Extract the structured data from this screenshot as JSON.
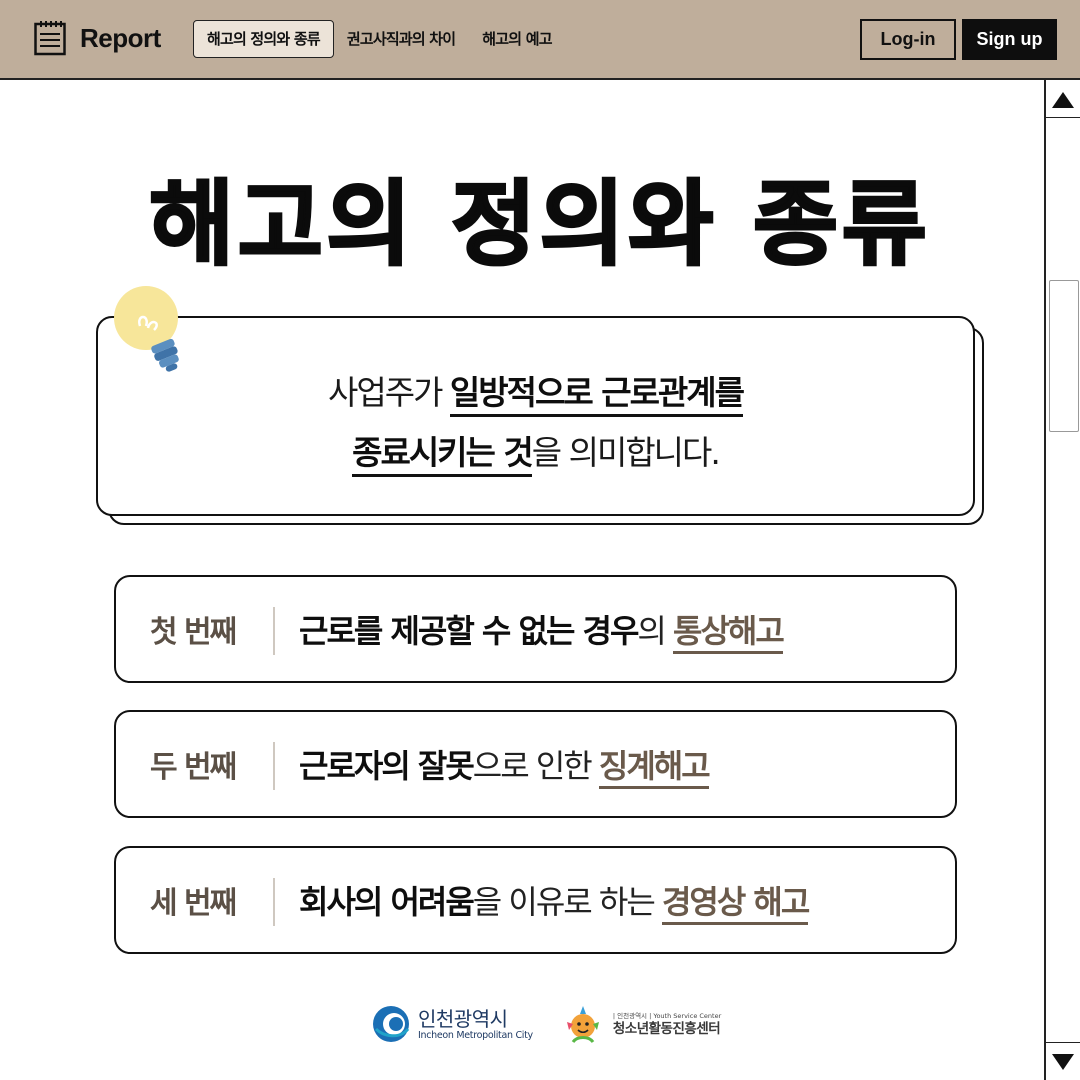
{
  "header": {
    "app_title": "Report",
    "tabs": [
      {
        "label": "해고의 정의와 종류",
        "active": true
      },
      {
        "label": "권고사직과의 차이",
        "active": false
      },
      {
        "label": "해고의 예고",
        "active": false
      }
    ],
    "login_label": "Log-in",
    "signup_label": "Sign up",
    "bar_color": "#bfae9b"
  },
  "main": {
    "title": "해고의 정의와 종류",
    "definition": {
      "line1_prefix": "사업주가 ",
      "line1_highlight": "일방적으로 근로관계를",
      "line2_highlight": "종료시키는 것",
      "line2_suffix": "을 의미합니다."
    },
    "types": [
      {
        "ordinal": "첫 번째",
        "bold": "근로를 제공할 수 없는 경우",
        "regular": "의 ",
        "underlined": "통상해고"
      },
      {
        "ordinal": "두 번째",
        "bold": "근로자의 잘못",
        "regular": "으로 인한 ",
        "underlined": "징계해고"
      },
      {
        "ordinal": "세 번째",
        "bold": "회사의 어려움",
        "regular": "을 이유로 하는 ",
        "underlined": "경영상 해고"
      }
    ]
  },
  "footer": {
    "incheon_ko": "인천광역시",
    "incheon_en": "Incheon Metropolitan City",
    "youth_small": "| 인천광역시 | Youth Service Center",
    "youth_ko": "청소년활동진흥센터"
  },
  "icons": {
    "app": "notepad-icon",
    "definition": "lightbulb-icon",
    "scroll_up": "scroll-up-arrow-icon",
    "scroll_down": "scroll-down-arrow-icon"
  }
}
